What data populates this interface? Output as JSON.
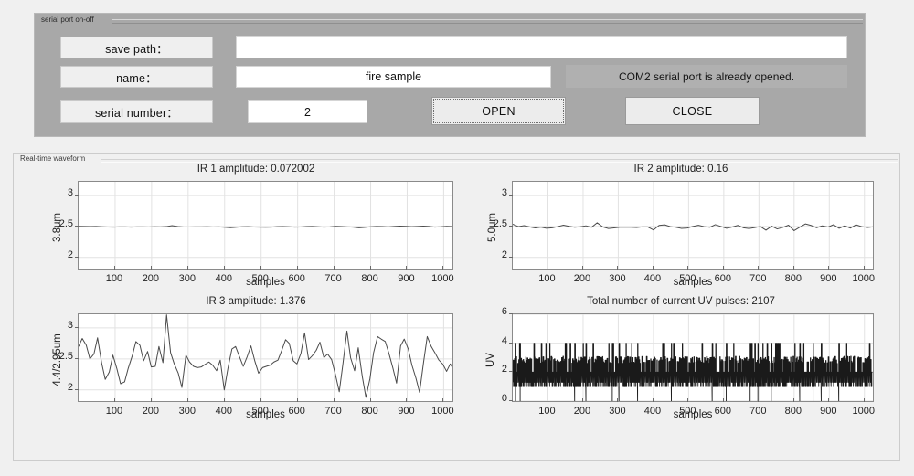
{
  "serial_panel": {
    "title": "serial port on-off",
    "fields": [
      {
        "label": "save path：",
        "value": "",
        "placeholder": ""
      },
      {
        "label": "name：",
        "value": "fire sample",
        "placeholder": ""
      },
      {
        "label": "serial number：",
        "value": "2",
        "placeholder": ""
      }
    ],
    "status_message": "COM2 serial port is already opened.",
    "open_button": "OPEN",
    "close_button": "CLOSE"
  },
  "waveform_panel": {
    "title": "Real-time waveform"
  },
  "chart_data": [
    {
      "id": "ir1",
      "type": "line",
      "title": "IR 1 amplitude: 0.072002",
      "xlabel": "samples",
      "ylabel": "3.8um",
      "xlim": [
        0,
        1024
      ],
      "ylim": [
        1.82,
        3.22
      ],
      "xticks": [
        100,
        200,
        300,
        400,
        500,
        600,
        700,
        800,
        900,
        1000
      ],
      "yticks": [
        2,
        2.5,
        3
      ],
      "grid": true,
      "line_color": "#4a4a4a",
      "x": [
        0,
        16,
        32,
        48,
        64,
        80,
        96,
        112,
        128,
        144,
        160,
        176,
        192,
        208,
        224,
        240,
        256,
        272,
        288,
        304,
        320,
        336,
        352,
        368,
        384,
        400,
        416,
        432,
        448,
        464,
        480,
        496,
        512,
        528,
        544,
        560,
        576,
        592,
        608,
        624,
        640,
        656,
        672,
        688,
        704,
        720,
        736,
        752,
        768,
        784,
        800,
        816,
        832,
        848,
        864,
        880,
        896,
        912,
        928,
        944,
        960,
        976,
        992,
        1008,
        1024
      ],
      "values": [
        2.501,
        2.499,
        2.498,
        2.5,
        2.494,
        2.49,
        2.488,
        2.493,
        2.492,
        2.489,
        2.492,
        2.493,
        2.49,
        2.494,
        2.492,
        2.497,
        2.512,
        2.498,
        2.491,
        2.49,
        2.493,
        2.492,
        2.494,
        2.49,
        2.492,
        2.487,
        2.48,
        2.487,
        2.494,
        2.496,
        2.491,
        2.489,
        2.487,
        2.489,
        2.496,
        2.498,
        2.494,
        2.489,
        2.491,
        2.497,
        2.5,
        2.494,
        2.489,
        2.493,
        2.501,
        2.497,
        2.492,
        2.489,
        2.478,
        2.485,
        2.494,
        2.5,
        2.497,
        2.492,
        2.499,
        2.505,
        2.501,
        2.496,
        2.5,
        2.505,
        2.499,
        2.489,
        2.494,
        2.502,
        2.497
      ]
    },
    {
      "id": "ir2",
      "type": "line",
      "title": "IR 2 amplitude: 0.16",
      "xlabel": "samples",
      "ylabel": "5.0um",
      "xlim": [
        0,
        1024
      ],
      "ylim": [
        1.82,
        3.22
      ],
      "xticks": [
        100,
        200,
        300,
        400,
        500,
        600,
        700,
        800,
        900,
        1000
      ],
      "yticks": [
        2,
        2.5,
        3
      ],
      "grid": true,
      "line_color": "#4a4a4a",
      "x": [
        0,
        16,
        32,
        48,
        64,
        80,
        96,
        112,
        128,
        144,
        160,
        176,
        192,
        208,
        224,
        240,
        256,
        272,
        288,
        304,
        320,
        336,
        352,
        368,
        384,
        400,
        416,
        432,
        448,
        464,
        480,
        496,
        512,
        528,
        544,
        560,
        576,
        592,
        608,
        624,
        640,
        656,
        672,
        688,
        704,
        720,
        736,
        752,
        768,
        784,
        800,
        816,
        832,
        848,
        864,
        880,
        896,
        912,
        928,
        944,
        960,
        976,
        992,
        1008,
        1024
      ],
      "values": [
        2.535,
        2.497,
        2.512,
        2.493,
        2.476,
        2.488,
        2.47,
        2.478,
        2.497,
        2.52,
        2.502,
        2.487,
        2.494,
        2.51,
        2.486,
        2.558,
        2.492,
        2.466,
        2.475,
        2.486,
        2.489,
        2.487,
        2.483,
        2.493,
        2.492,
        2.443,
        2.516,
        2.526,
        2.497,
        2.486,
        2.469,
        2.474,
        2.5,
        2.518,
        2.497,
        2.486,
        2.528,
        2.499,
        2.47,
        2.49,
        2.516,
        2.478,
        2.467,
        2.482,
        2.499,
        2.44,
        2.504,
        2.46,
        2.484,
        2.52,
        2.432,
        2.487,
        2.54,
        2.516,
        2.479,
        2.509,
        2.49,
        2.527,
        2.47,
        2.509,
        2.473,
        2.526,
        2.497,
        2.484,
        2.492
      ]
    },
    {
      "id": "ir3",
      "type": "line",
      "title": "IR 3 amplitude: 1.376",
      "xlabel": "samples",
      "ylabel": "4.4/2.95um",
      "xlim": [
        0,
        1024
      ],
      "ylim": [
        1.82,
        3.22
      ],
      "xticks": [
        100,
        200,
        300,
        400,
        500,
        600,
        700,
        800,
        900,
        1000
      ],
      "yticks": [
        2,
        2.5,
        3
      ],
      "grid": true,
      "line_color": "#4a4a4a",
      "x": [
        0,
        10,
        21,
        31,
        42,
        52,
        63,
        73,
        84,
        94,
        105,
        115,
        126,
        136,
        147,
        157,
        168,
        178,
        189,
        199,
        210,
        220,
        231,
        241,
        252,
        262,
        273,
        283,
        294,
        304,
        315,
        325,
        336,
        346,
        357,
        367,
        378,
        388,
        399,
        409,
        420,
        430,
        441,
        451,
        462,
        472,
        483,
        493,
        504,
        514,
        525,
        535,
        546,
        556,
        567,
        577,
        588,
        598,
        609,
        619,
        630,
        640,
        651,
        661,
        672,
        682,
        693,
        703,
        714,
        724,
        735,
        745,
        756,
        766,
        777,
        787,
        798,
        808,
        819,
        829,
        840,
        850,
        861,
        871,
        882,
        892,
        903,
        913,
        924,
        934,
        945,
        955,
        966,
        976,
        987,
        997,
        1008,
        1018,
        1024
      ],
      "values": [
        2.7,
        2.83,
        2.72,
        2.5,
        2.58,
        2.84,
        2.44,
        2.17,
        2.29,
        2.56,
        2.34,
        2.1,
        2.13,
        2.35,
        2.55,
        2.78,
        2.72,
        2.47,
        2.62,
        2.37,
        2.38,
        2.7,
        2.44,
        3.21,
        2.6,
        2.42,
        2.27,
        2.04,
        2.56,
        2.45,
        2.38,
        2.36,
        2.37,
        2.41,
        2.45,
        2.4,
        2.31,
        2.48,
        2.0,
        2.35,
        2.66,
        2.7,
        2.53,
        2.38,
        2.54,
        2.71,
        2.46,
        2.27,
        2.36,
        2.38,
        2.4,
        2.45,
        2.48,
        2.63,
        2.81,
        2.75,
        2.47,
        2.42,
        2.59,
        2.92,
        2.49,
        2.55,
        2.64,
        2.77,
        2.52,
        2.58,
        2.49,
        2.26,
        1.97,
        2.42,
        2.95,
        2.52,
        2.31,
        2.68,
        2.22,
        1.88,
        2.18,
        2.6,
        2.86,
        2.82,
        2.78,
        2.59,
        2.35,
        2.11,
        2.71,
        2.82,
        2.66,
        2.4,
        2.19,
        1.96,
        2.45,
        2.86,
        2.7,
        2.6,
        2.48,
        2.42,
        2.3,
        2.42,
        2.36
      ]
    },
    {
      "id": "uv",
      "type": "line",
      "title": "Total number of current UV pulses: 2107",
      "xlabel": "samples",
      "ylabel": "UV",
      "xlim": [
        0,
        1024
      ],
      "ylim": [
        0,
        6
      ],
      "xticks": [
        100,
        200,
        300,
        400,
        500,
        600,
        700,
        800,
        900,
        1000
      ],
      "yticks": [
        0,
        2,
        4,
        6
      ],
      "grid": true,
      "line_color": "#1a1a1a",
      "note": "dense noisy pulse train, values mostly alternating between 1 and 3 with spikes to 4 and drops to 0",
      "baseline": 2,
      "spike_high": 4,
      "spike_low": 0,
      "pulse_count": 2107
    }
  ]
}
